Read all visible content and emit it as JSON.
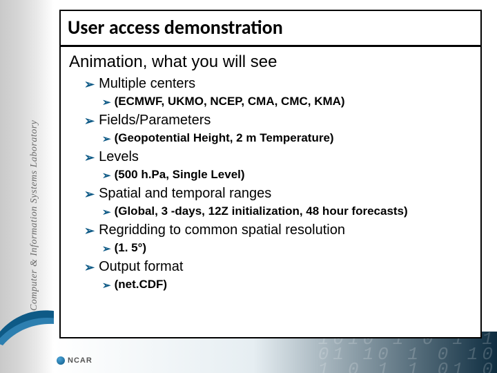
{
  "leftBand": {
    "verticalLabel": "Computer & Information Systems Laboratory"
  },
  "logo": {
    "text": "NCAR"
  },
  "title": "User access demonstration",
  "subtitle": "Animation, what you will see",
  "items": [
    {
      "label": "Multiple centers",
      "sub": "(ECMWF, UKMO, NCEP, CMA, CMC, KMA)"
    },
    {
      "label": "Fields/Parameters",
      "sub": "(Geopotential Height, 2 m Temperature)"
    },
    {
      "label": "Levels",
      "sub": "(500 h.Pa, Single Level)"
    },
    {
      "label": "Spatial and temporal ranges",
      "sub": "(Global, 3 -days, 12Z initialization, 48 hour forecasts)"
    },
    {
      "label": "Regridding to common spatial resolution",
      "sub": "(1. 5°)"
    },
    {
      "label": "Output format",
      "sub": "(net.CDF)"
    }
  ],
  "binaryArt": "1010 1 0 1 1\n 01 10 1 0 10\n1 0 1 1 01 0"
}
